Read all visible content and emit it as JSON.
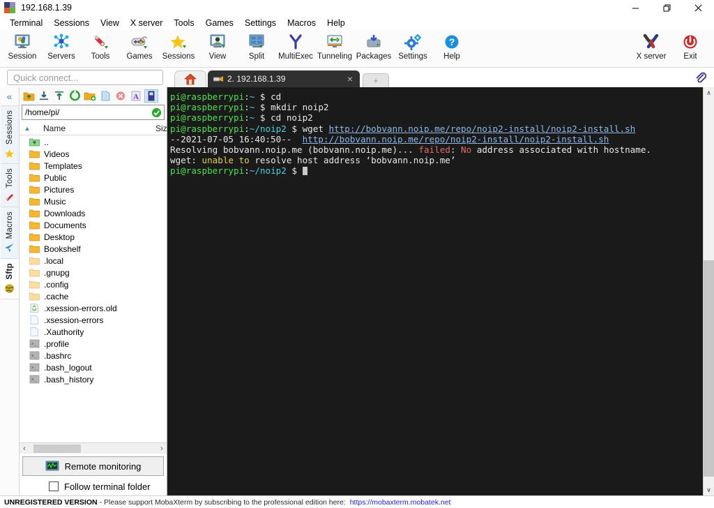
{
  "window": {
    "title": "192.168.1.39",
    "controls": {
      "minimize": "minimize",
      "maximize": "maximize",
      "close": "close"
    }
  },
  "menu": {
    "items": [
      "Terminal",
      "Sessions",
      "View",
      "X server",
      "Tools",
      "Games",
      "Settings",
      "Macros",
      "Help"
    ]
  },
  "toolbar": {
    "left_buttons": [
      {
        "label": "Session",
        "icon": "session-icon"
      },
      {
        "label": "Servers",
        "icon": "servers-icon"
      },
      {
        "label": "Tools",
        "icon": "tools-icon"
      },
      {
        "label": "Games",
        "icon": "games-icon"
      },
      {
        "label": "Sessions",
        "icon": "sessions-star-icon"
      },
      {
        "label": "View",
        "icon": "view-icon"
      },
      {
        "label": "Split",
        "icon": "split-icon"
      },
      {
        "label": "MultiExec",
        "icon": "multiexec-icon"
      },
      {
        "label": "Tunneling",
        "icon": "tunneling-icon"
      },
      {
        "label": "Packages",
        "icon": "packages-icon"
      },
      {
        "label": "Settings",
        "icon": "settings-gear-icon"
      },
      {
        "label": "Help",
        "icon": "help-icon"
      }
    ],
    "right_buttons": [
      {
        "label": "X server",
        "icon": "x-server-icon"
      },
      {
        "label": "Exit",
        "icon": "power-exit-icon"
      }
    ]
  },
  "quick_connect": {
    "placeholder": "Quick connect...",
    "value": ""
  },
  "tabs": {
    "home_label": "home-tab",
    "open": [
      {
        "label": "2. 192.168.1.39",
        "icon": "ssh-key-icon",
        "active": true
      }
    ],
    "new_tab_label": "+",
    "close_label": "×"
  },
  "attachment": {
    "icon": "paperclip-icon"
  },
  "rail": {
    "collapse_label": "«",
    "tabs": [
      {
        "label": "Sessions",
        "icon": "star-icon",
        "active": false
      },
      {
        "label": "Tools",
        "icon": "swiss-knife-icon",
        "active": false
      },
      {
        "label": "Macros",
        "icon": "paper-plane-icon",
        "active": false
      },
      {
        "label": "Sftp",
        "icon": "globe-icon",
        "active": true
      }
    ]
  },
  "file_browser": {
    "toolbar_icons": [
      {
        "name": "parent-folder-icon",
        "selected": false
      },
      {
        "name": "download-icon",
        "selected": false
      },
      {
        "name": "upload-icon",
        "selected": false
      },
      {
        "name": "refresh-icon",
        "selected": false
      },
      {
        "name": "new-folder-icon",
        "selected": false
      },
      {
        "name": "new-file-icon",
        "selected": false
      },
      {
        "name": "delete-icon",
        "selected": false
      },
      {
        "name": "text-edit-icon",
        "selected": false
      },
      {
        "name": "drive-view-icon",
        "selected": true
      }
    ],
    "path": "/home/pi/",
    "path_status_icon": "checkmark-ok-icon",
    "columns": [
      "Name",
      "Size"
    ],
    "sort_arrow": "▲",
    "rows": [
      {
        "name": "..",
        "type": "parent",
        "size": ""
      },
      {
        "name": "Videos",
        "type": "folder",
        "size": ""
      },
      {
        "name": "Templates",
        "type": "folder",
        "size": ""
      },
      {
        "name": "Public",
        "type": "folder",
        "size": ""
      },
      {
        "name": "Pictures",
        "type": "folder",
        "size": ""
      },
      {
        "name": "Music",
        "type": "folder",
        "size": ""
      },
      {
        "name": "Downloads",
        "type": "folder",
        "size": ""
      },
      {
        "name": "Documents",
        "type": "folder",
        "size": ""
      },
      {
        "name": "Desktop",
        "type": "folder",
        "size": ""
      },
      {
        "name": "Bookshelf",
        "type": "folder",
        "size": ""
      },
      {
        "name": ".local",
        "type": "hfolder",
        "size": ""
      },
      {
        "name": ".gnupg",
        "type": "hfolder",
        "size": ""
      },
      {
        "name": ".config",
        "type": "hfolder",
        "size": ""
      },
      {
        "name": ".cache",
        "type": "hfolder",
        "size": ""
      },
      {
        "name": ".xsession-errors.old",
        "type": "recycle",
        "size": ""
      },
      {
        "name": ".xsession-errors",
        "type": "file",
        "size": ""
      },
      {
        "name": ".Xauthority",
        "type": "file",
        "size": ""
      },
      {
        "name": ".profile",
        "type": "script",
        "size": ""
      },
      {
        "name": ".bashrc",
        "type": "script",
        "size": ""
      },
      {
        "name": ".bash_logout",
        "type": "script",
        "size": ""
      },
      {
        "name": ".bash_history",
        "type": "script",
        "size": ""
      }
    ],
    "remote_monitoring": {
      "label": "Remote monitoring",
      "icon": "monitor-graph-icon"
    },
    "follow_terminal": {
      "label": "Follow terminal folder",
      "checked": false
    },
    "hscroll": {
      "left": "‹",
      "right": "›"
    }
  },
  "terminal": {
    "lines": [
      {
        "segments": [
          {
            "t": "pi@raspberrypi",
            "c": "g"
          },
          {
            "t": ":",
            "c": "w"
          },
          {
            "t": "~",
            "c": "c"
          },
          {
            "t": " $ ",
            "c": "w"
          },
          {
            "t": "cd",
            "c": "w"
          }
        ]
      },
      {
        "segments": [
          {
            "t": "pi@raspberrypi",
            "c": "g"
          },
          {
            "t": ":",
            "c": "w"
          },
          {
            "t": "~",
            "c": "c"
          },
          {
            "t": " $ ",
            "c": "w"
          },
          {
            "t": "mkdir noip2",
            "c": "w"
          }
        ]
      },
      {
        "segments": [
          {
            "t": "pi@raspberrypi",
            "c": "g"
          },
          {
            "t": ":",
            "c": "w"
          },
          {
            "t": "~",
            "c": "c"
          },
          {
            "t": " $ ",
            "c": "w"
          },
          {
            "t": "cd noip2",
            "c": "w"
          }
        ]
      },
      {
        "segments": [
          {
            "t": "pi@raspberrypi",
            "c": "g"
          },
          {
            "t": ":",
            "c": "w"
          },
          {
            "t": "~/noip2",
            "c": "c"
          },
          {
            "t": " $ ",
            "c": "w"
          },
          {
            "t": "wget ",
            "c": "w"
          },
          {
            "t": "http://bobvann.noip.me/repo/noip2-install/noip2-install.sh",
            "c": "lnk"
          }
        ]
      },
      {
        "segments": [
          {
            "t": "--2021-07-05 16:40:50--  ",
            "c": "w"
          },
          {
            "t": "http://bobvann.noip.me/repo/noip2-install/noip2-install.sh",
            "c": "lnk"
          }
        ]
      },
      {
        "segments": [
          {
            "t": "Resolving bobvann.noip.me (bobvann.noip.me)... ",
            "c": "w"
          },
          {
            "t": "failed",
            "c": "r"
          },
          {
            "t": ": ",
            "c": "w"
          },
          {
            "t": "No",
            "c": "r"
          },
          {
            "t": " address associated with hostname.",
            "c": "w"
          }
        ]
      },
      {
        "segments": [
          {
            "t": "wget: ",
            "c": "w"
          },
          {
            "t": "unable to",
            "c": "y"
          },
          {
            "t": " resolve host address ‘bobvann.noip.me’",
            "c": "w"
          }
        ]
      },
      {
        "segments": [
          {
            "t": "pi@raspberrypi",
            "c": "g"
          },
          {
            "t": ":",
            "c": "w"
          },
          {
            "t": "~/noip2",
            "c": "c"
          },
          {
            "t": " $ ",
            "c": "w"
          }
        ],
        "cursor": true
      }
    ]
  },
  "scrollbar": {
    "up": "∧",
    "down": "∨"
  },
  "statusbar": {
    "badge": "UNREGISTERED VERSION",
    "message": "-  Please support MobaXterm by subscribing to the professional edition here:",
    "link": "https://mobaxterm.mobatek.net"
  },
  "colors": {
    "terminal_bg": "#1a1a1a",
    "prompt_green": "#4ee24e",
    "path_cyan": "#4ad0e0",
    "error_red": "#e06c6c",
    "warn_yellow": "#e0d24a",
    "link_blue": "#8fb8e8",
    "accent_blue": "#3b7fc4",
    "folder_yellow": "#f8b733"
  }
}
